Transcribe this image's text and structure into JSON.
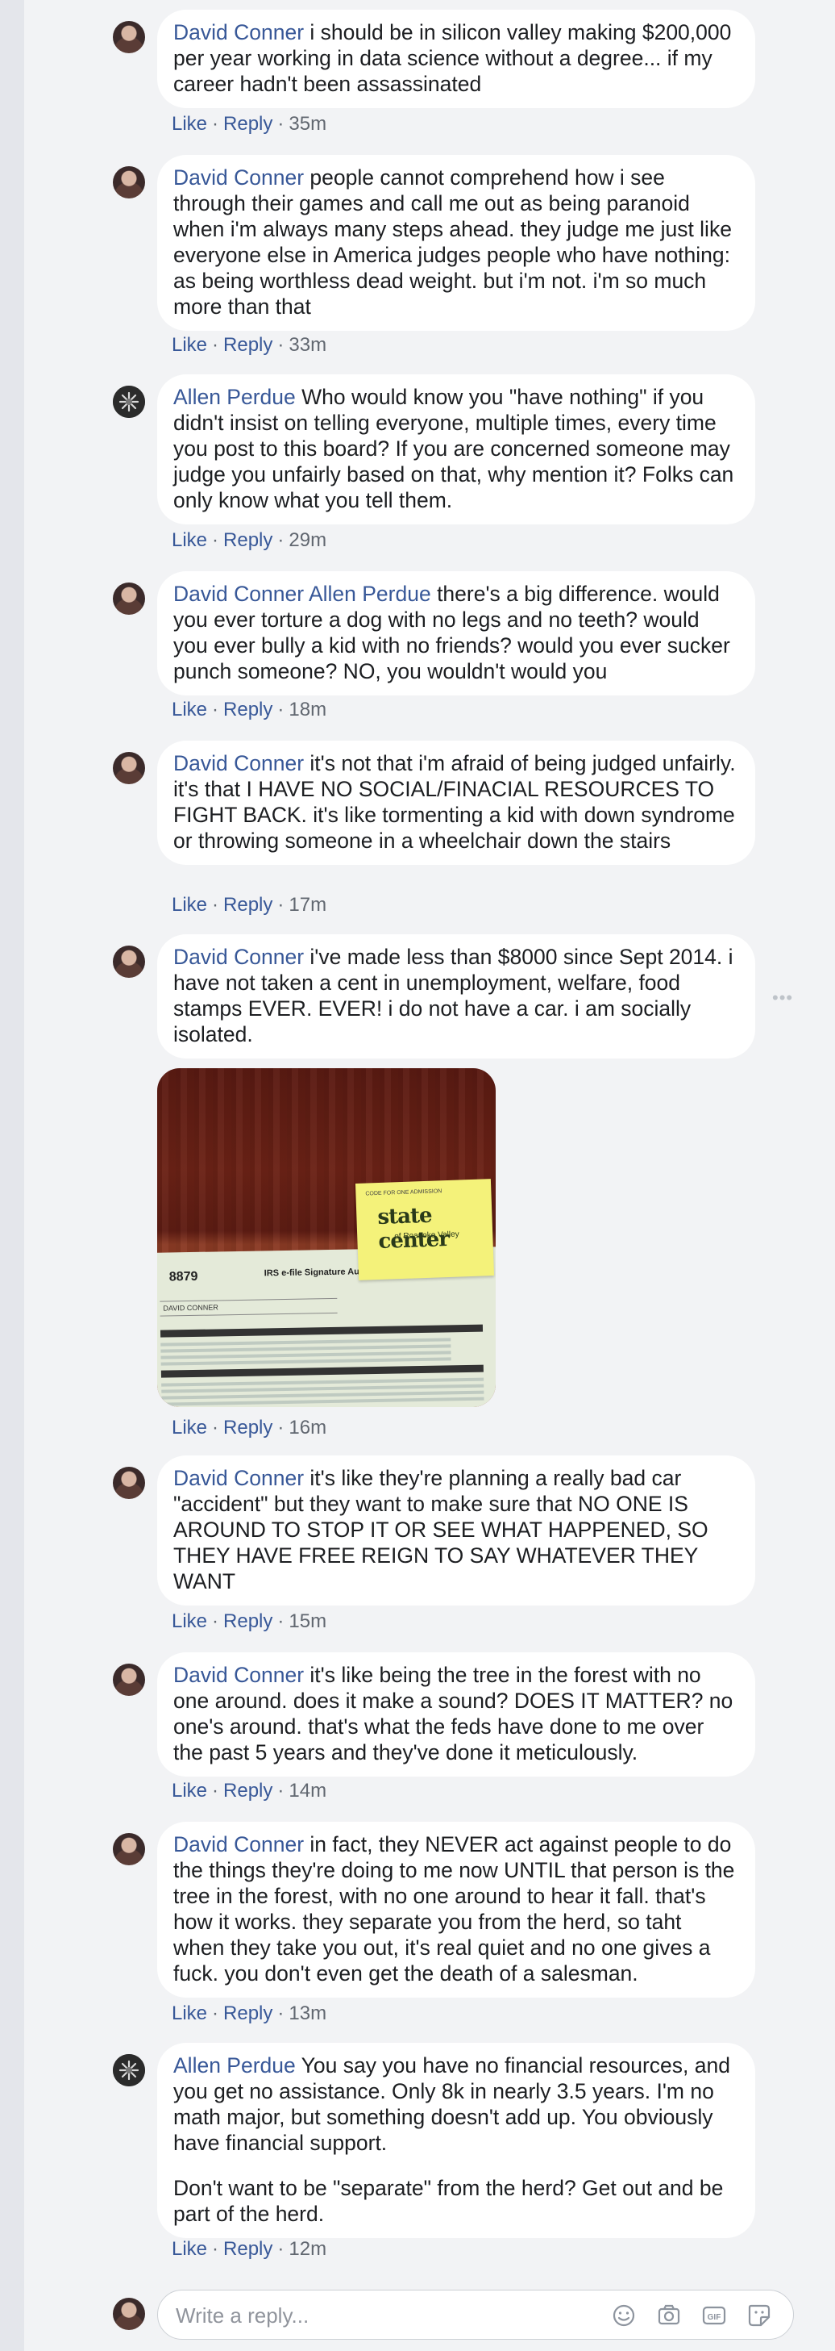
{
  "comments": [
    {
      "author": "David Conner",
      "mention": "",
      "paragraphs": [
        "i should be in silicon valley making $200,000 per year working in data science without a degree... if my career hadn't been assassinated"
      ],
      "like": "Like",
      "reply": "Reply",
      "time": "35m"
    },
    {
      "author": "David Conner",
      "mention": "",
      "paragraphs": [
        "people cannot comprehend how i see through their games and call me out as being paranoid when i'm always many steps ahead. they judge me just like everyone else in America judges people who have nothing: as being worthless dead weight. but i'm not. i'm so much more than that"
      ],
      "like": "Like",
      "reply": "Reply",
      "time": "33m"
    },
    {
      "author": "Allen Perdue",
      "mention": "",
      "paragraphs": [
        "Who would know you \"have nothing\" if you didn't insist on telling everyone, multiple times, every time you post to this board? If you are concerned someone may judge you unfairly based on that, why mention it? Folks can only know what you tell them."
      ],
      "like": "Like",
      "reply": "Reply",
      "time": "29m"
    },
    {
      "author": "David Conner",
      "mention": "Allen Perdue",
      "paragraphs": [
        "there's a big difference. would you ever torture a dog with no legs and no teeth? would you ever bully a kid with no friends? would you ever sucker punch someone? NO, you wouldn't would you"
      ],
      "like": "Like",
      "reply": "Reply",
      "time": "18m"
    },
    {
      "author": "David Conner",
      "mention": "",
      "paragraphs": [
        "it's not that i'm afraid of being judged unfairly. it's that I HAVE NO SOCIAL/FINACIAL RESOURCES TO FIGHT BACK. it's like tormenting a kid with down syndrome or throwing someone in a wheelchair down the stairs"
      ],
      "like": "Like",
      "reply": "Reply",
      "time": "17m"
    },
    {
      "author": "David Conner",
      "mention": "",
      "paragraphs": [
        "i've made less than $8000 since Sept 2014. i have not taken a cent in unemployment, welfare, food stamps EVER. EVER! i do not have a car. i am socially isolated."
      ],
      "like": "Like",
      "reply": "Reply",
      "time": "16m"
    },
    {
      "author": "David Conner",
      "mention": "",
      "paragraphs": [
        "it's like they're planning a really bad car \"accident\" but they want to make sure that NO ONE IS AROUND TO STOP IT OR SEE WHAT HAPPENED, SO THEY HAVE FREE REIGN TO SAY WHATEVER THEY WANT"
      ],
      "like": "Like",
      "reply": "Reply",
      "time": "15m"
    },
    {
      "author": "David Conner",
      "mention": "",
      "paragraphs": [
        "it's like being the tree in the forest with no one around. does it make a sound? DOES IT MATTER? no one's around. that's what the feds have done to me over the past 5 years and they've done it meticulously."
      ],
      "like": "Like",
      "reply": "Reply",
      "time": "14m"
    },
    {
      "author": "David Conner",
      "mention": "",
      "paragraphs": [
        "in fact, they NEVER act against people to do the things they're doing to me now UNTIL that person is the tree in the forest, with no one around to hear it fall. that's how it works. they separate you from the herd, so taht when they take you out, it's real quiet and no one gives a fuck. you don't even get the death of a salesman."
      ],
      "like": "Like",
      "reply": "Reply",
      "time": "13m"
    },
    {
      "author": "Allen Perdue",
      "mention": "",
      "paragraphs": [
        "You say you have no financial resources, and you get no assistance. Only 8k in nearly 3.5 years. I'm no math major, but something doesn't add up. You obviously have financial support.",
        "Don't want to be \"separate\" from the herd? Get out and be part of the herd."
      ],
      "like": "Like",
      "reply": "Reply",
      "time": "12m"
    }
  ],
  "attachment": {
    "form_number": "8879",
    "form_title": "IRS e-file Signature Author",
    "taxpayer_name": "DAVID CONNER",
    "sticky_brand": "state center",
    "sticky_sub": "of Roanoke Valley",
    "sticky_tiny": "CODE FOR ONE ADMISSION"
  },
  "more_options": "•••",
  "reply_box": {
    "placeholder": "Write a reply...",
    "icons": [
      "emoji-icon",
      "camera-icon",
      "gif-icon",
      "sticker-icon"
    ]
  },
  "colors": {
    "author_link": "#385898",
    "meta": "#616770",
    "bubble": "#ffffff",
    "background": "#f2f3f5"
  }
}
